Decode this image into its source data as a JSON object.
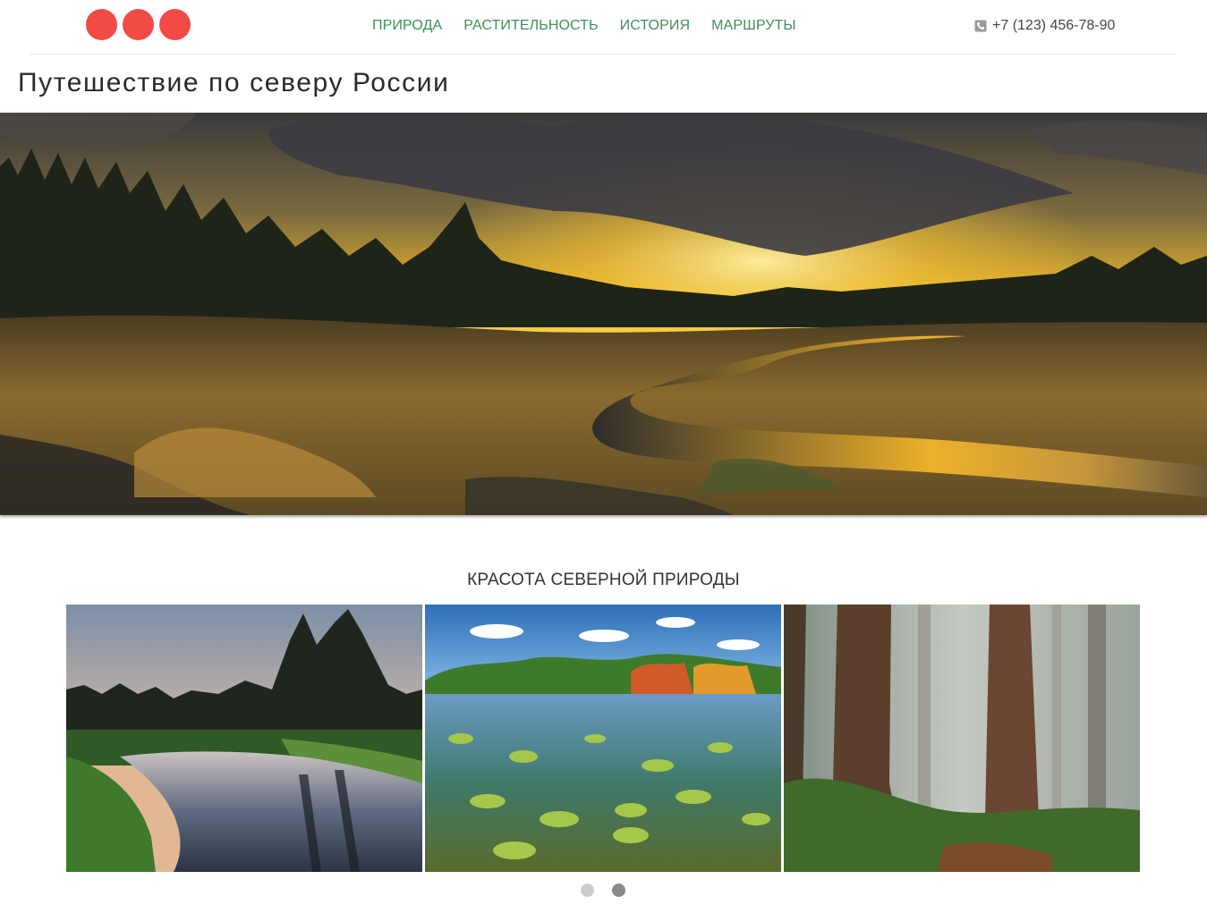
{
  "nav": {
    "items": [
      {
        "label": "ПРИРОДА"
      },
      {
        "label": "РАСТИТЕЛЬНОСТЬ"
      },
      {
        "label": "ИСТОРИЯ"
      },
      {
        "label": "МАРШРУТЫ"
      }
    ]
  },
  "contact": {
    "phone": "+7 (123) 456-78-90",
    "icon": "phone-icon"
  },
  "page": {
    "title": "Путешествие по северу России"
  },
  "hero": {
    "image": "sunset-river-marsh-photo"
  },
  "gallery": {
    "title": "КРАСОТА СЕВЕРНОЙ ПРИРОДЫ",
    "photos": [
      {
        "name": "river-pines-dusk-photo"
      },
      {
        "name": "lily-pad-lake-photo"
      },
      {
        "name": "foggy-redwood-forest-photo"
      }
    ],
    "pagination": {
      "count": 2,
      "active": 2
    }
  },
  "colors": {
    "accent_nav": "#3f8f5b",
    "logo": "#f24b45",
    "dot_inactive": "#cccccc",
    "dot_active": "#8a8a8a"
  }
}
